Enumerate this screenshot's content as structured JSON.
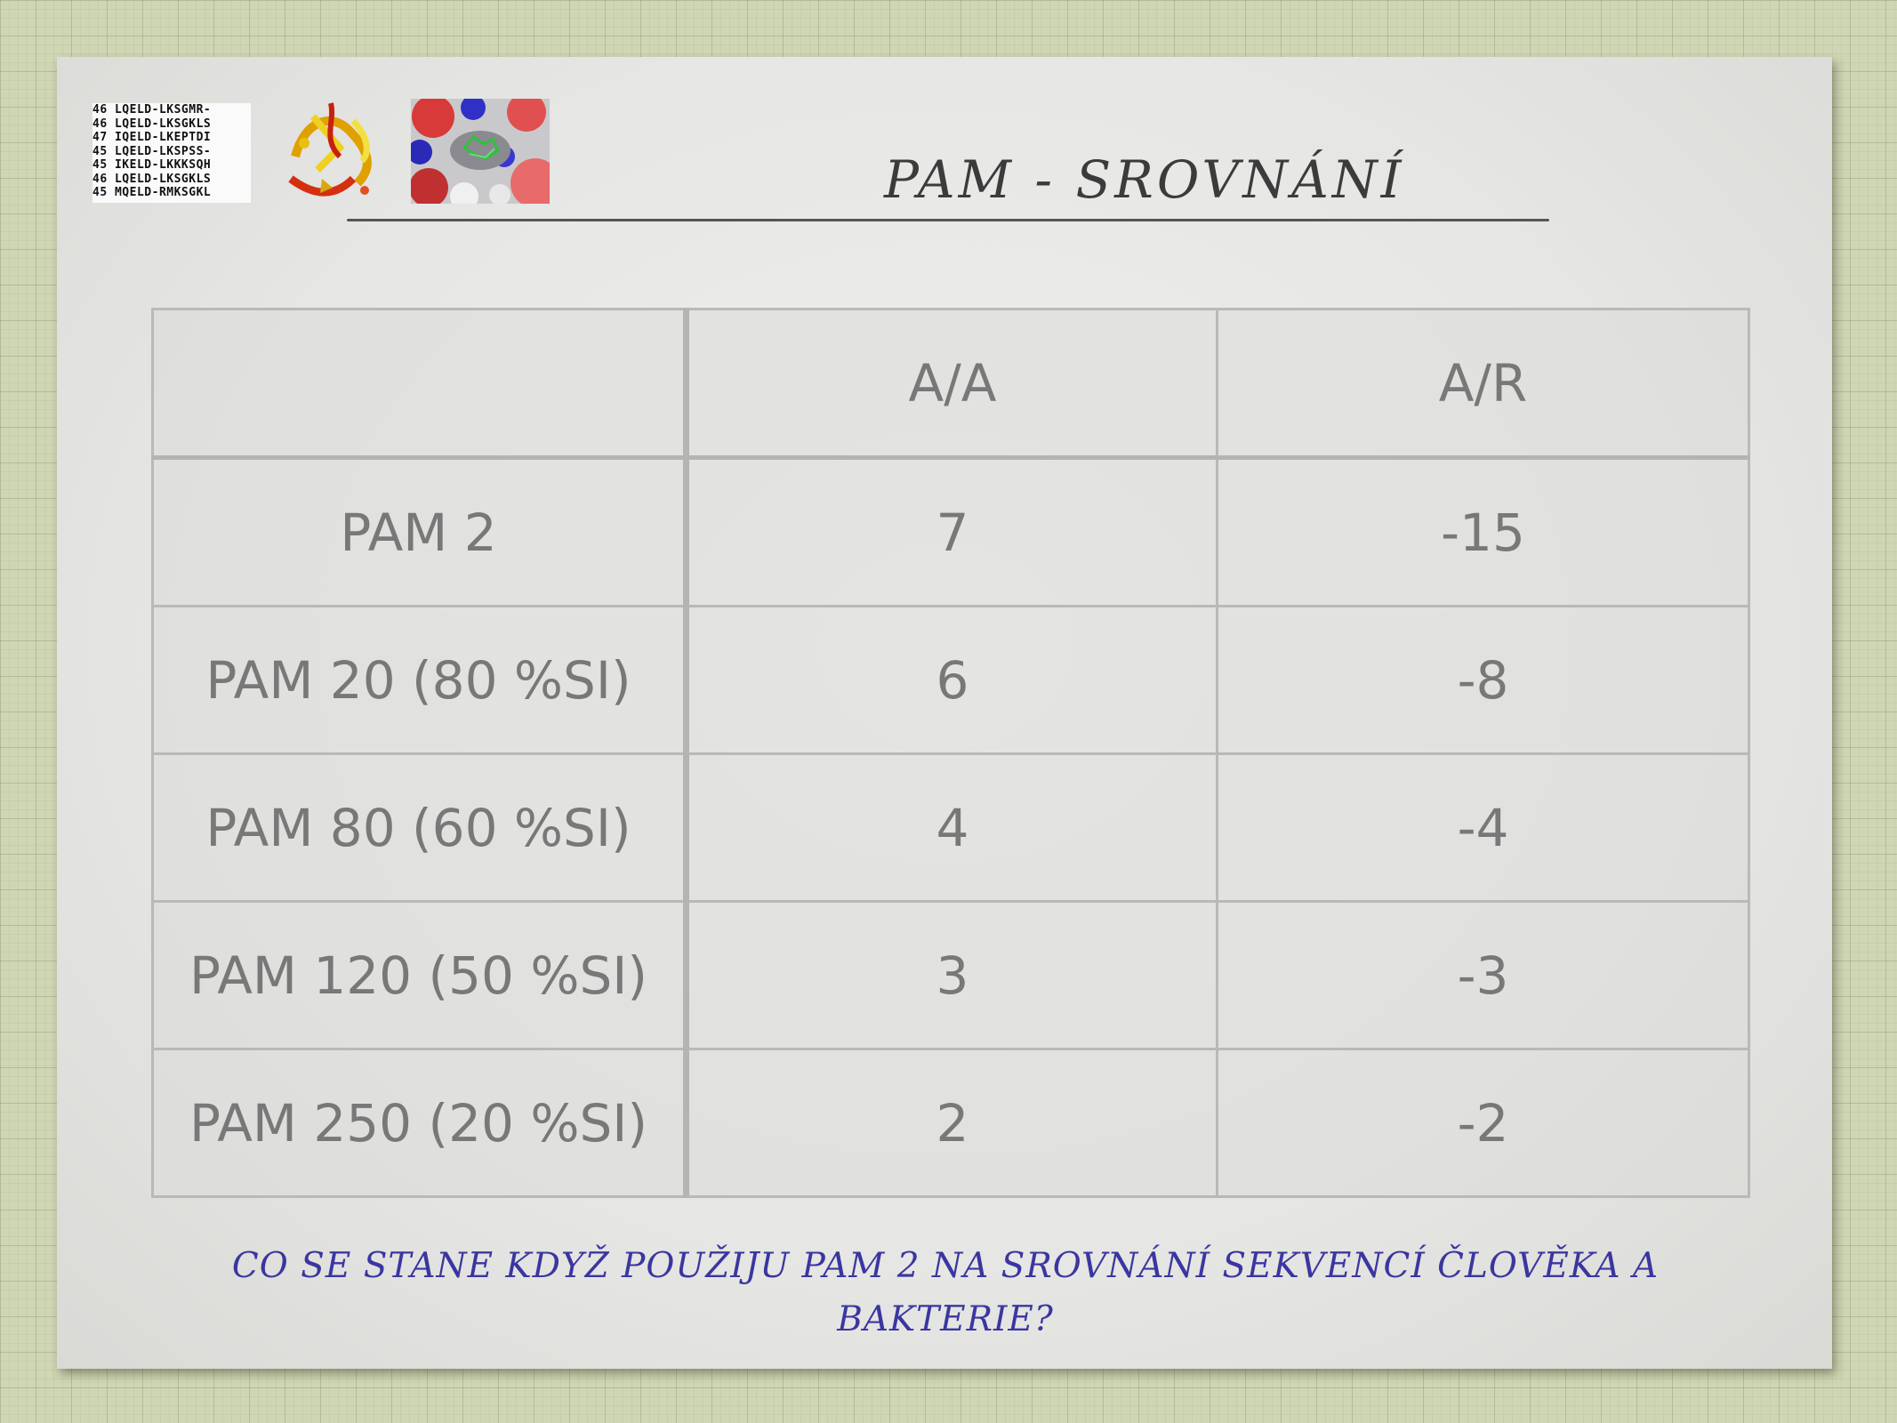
{
  "slide": {
    "title": "PAM - SROVNÁNÍ",
    "question": "CO SE STANE KDYŽ POUŽIJU PAM 2 NA SROVNÁNÍ SEKVENCÍ ČLOVĚKA A BAKTERIE?"
  },
  "images": {
    "sequence_alignment": {
      "lines": [
        "46 LQELD-LKSGMR-",
        "46 LQELD-LKSGKLS",
        "47 IQELD-LKEPTDI",
        "45 LQELD-LKSPSS-",
        "45 IKELD-LKKKSQH",
        "46 LQELD-LKSGKLS",
        "45 MQELD-RMKSGKL"
      ]
    }
  },
  "table": {
    "columns": [
      "",
      "A/A",
      "A/R"
    ],
    "rows": [
      {
        "label": "PAM 2",
        "aa": "7",
        "ar": "-15"
      },
      {
        "label": "PAM 20 (80 %SI)",
        "aa": "6",
        "ar": "-8"
      },
      {
        "label": "PAM 80 (60 %SI)",
        "aa": "4",
        "ar": "-4"
      },
      {
        "label": "PAM 120 (50 %SI)",
        "aa": "3",
        "ar": "-3"
      },
      {
        "label": "PAM 250 (20 %SI)",
        "aa": "2",
        "ar": "-2"
      }
    ]
  }
}
